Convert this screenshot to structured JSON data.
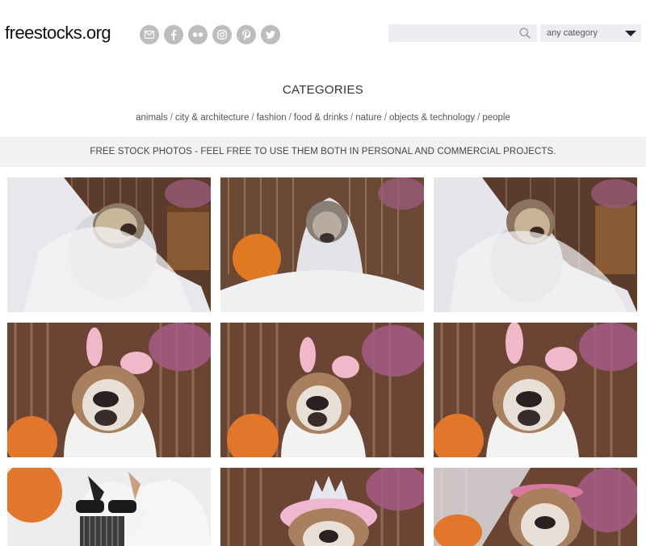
{
  "header": {
    "logo": "freestocks.org",
    "social_icons": [
      "email-icon",
      "facebook-icon",
      "flickr-icon",
      "instagram-icon",
      "pinterest-icon",
      "twitter-icon"
    ],
    "search": {
      "placeholder": "",
      "icon": "search-icon"
    },
    "category_select": {
      "value": "any category"
    }
  },
  "categories": {
    "title": "CATEGORIES",
    "links": [
      "animals",
      "city & architecture",
      "fashion",
      "food & drinks",
      "nature",
      "objects & technology",
      "people"
    ],
    "separator": "/"
  },
  "banner": {
    "text": "FREE STOCK PHOTOS - FEEL FREE TO USE THEM BOTH IN PERSONAL AND COMMERCIAL PROJECTS."
  },
  "photos": [
    {
      "subject": "bulldog-veil"
    },
    {
      "subject": "bulldog-veil"
    },
    {
      "subject": "bulldog-veil"
    },
    {
      "subject": "bulldog-bunny-ears"
    },
    {
      "subject": "bulldog-bunny-ears"
    },
    {
      "subject": "bulldog-bunny-ears"
    },
    {
      "subject": "bulldog-sunglasses"
    },
    {
      "subject": "bulldog-tiara"
    },
    {
      "subject": "bulldog-flower-crown"
    }
  ],
  "colors": {
    "icon_bg": "#bdbdbd",
    "search_bg": "#eceef1",
    "banner_bg": "#f2f2f2"
  }
}
